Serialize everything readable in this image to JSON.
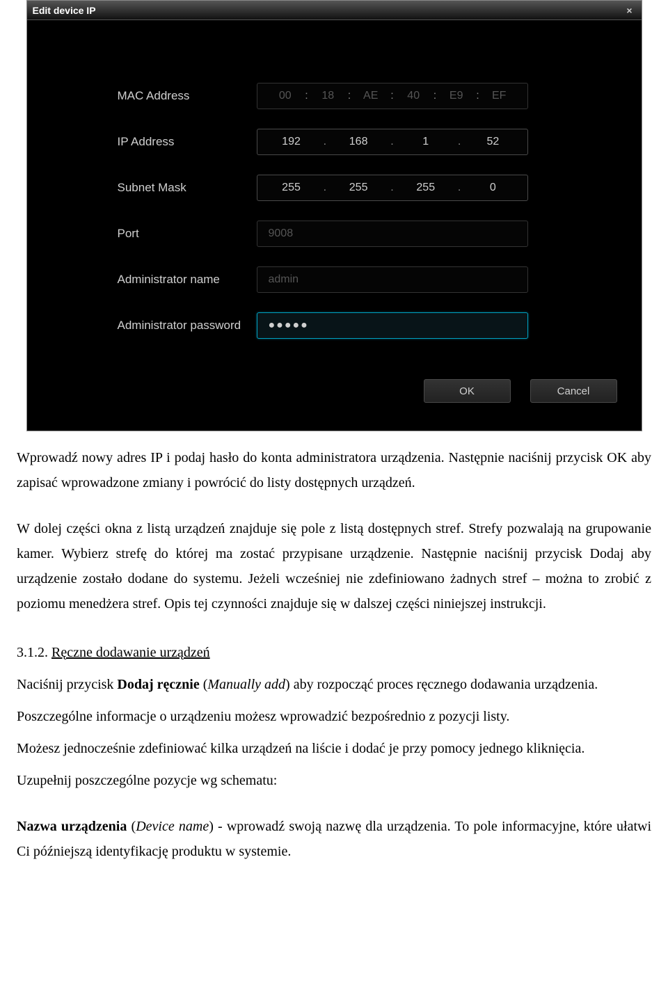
{
  "dialog": {
    "title": "Edit device IP",
    "close": "×",
    "rows": {
      "mac_label": "MAC Address",
      "mac": {
        "o1": "00",
        "o2": "18",
        "o3": "AE",
        "o4": "40",
        "o5": "E9",
        "o6": "EF",
        "sep": ":"
      },
      "ip_label": "IP Address",
      "ip": {
        "o1": "192",
        "o2": "168",
        "o3": "1",
        "o4": "52",
        "sep": "."
      },
      "subnet_label": "Subnet Mask",
      "subnet": {
        "o1": "255",
        "o2": "255",
        "o3": "255",
        "o4": "0",
        "sep": "."
      },
      "port_label": "Port",
      "port_value": "9008",
      "admin_name_label": "Administrator name",
      "admin_name_value": "admin",
      "admin_pw_label": "Administrator password",
      "admin_pw_value": "●●●●●"
    },
    "buttons": {
      "ok": "OK",
      "cancel": "Cancel"
    }
  },
  "doc": {
    "p1": "Wprowadź nowy adres IP i podaj hasło do konta administratora urządzenia. Następnie naciśnij przycisk OK aby zapisać wprowadzone zmiany i powrócić do listy dostępnych urządzeń.",
    "p2": "W dolej części okna z listą urządzeń znajduje się pole z listą dostępnych stref. Strefy pozwalają na grupowanie kamer. Wybierz strefę do której ma zostać przypisane urządzenie. Następnie naciśnij przycisk Dodaj aby urządzenie zostało dodane do systemu. Jeżeli wcześniej nie zdefiniowano żadnych stref – można to zrobić z poziomu menedżera stref. Opis tej czynności znajduje się w dalszej części niniejszej instrukcji.",
    "h_num": "3.1.2. ",
    "h_text": "Ręczne dodawanie urządzeń",
    "p3a": "Naciśnij przycisk ",
    "p3b": "Dodaj ręcznie",
    "p3c": " (",
    "p3d": "Manually add",
    "p3e": ") aby rozpocząć proces ręcznego dodawania urządzenia.",
    "p4": "Poszczególne informacje o urządzeniu możesz wprowadzić bezpośrednio z pozycji listy.",
    "p5": "Możesz jednocześnie zdefiniować kilka urządzeń na liście i dodać je przy pomocy jednego kliknięcia.",
    "p6": "Uzupełnij poszczególne pozycje wg schematu:",
    "p7a": "Nazwa urządzenia",
    "p7b": " (",
    "p7c": "Device name",
    "p7d": ")  - wprowadź swoją nazwę dla urządzenia. To pole informacyjne, które ułatwi Ci późniejszą identyfikację produktu w systemie."
  }
}
